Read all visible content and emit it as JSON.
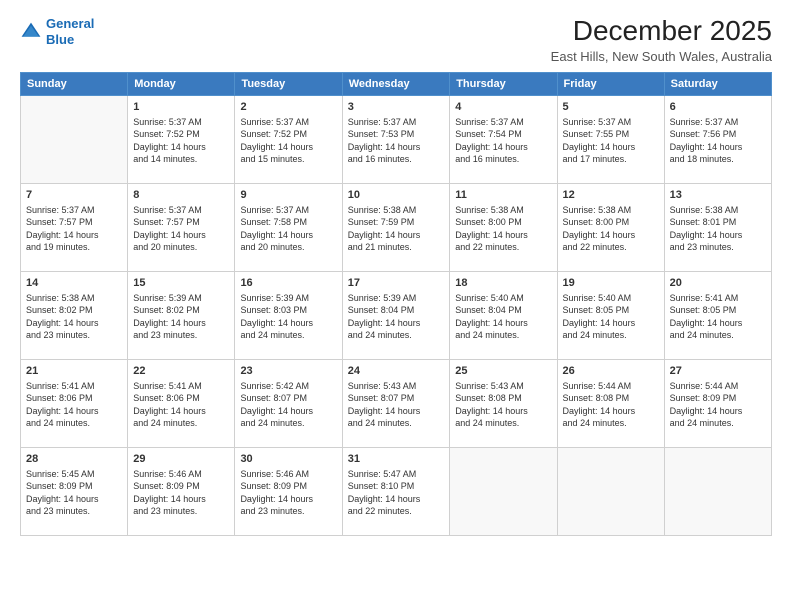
{
  "header": {
    "logo_line1": "General",
    "logo_line2": "Blue",
    "title": "December 2025",
    "subtitle": "East Hills, New South Wales, Australia"
  },
  "calendar": {
    "days_of_week": [
      "Sunday",
      "Monday",
      "Tuesday",
      "Wednesday",
      "Thursday",
      "Friday",
      "Saturday"
    ],
    "weeks": [
      [
        {
          "num": "",
          "info": ""
        },
        {
          "num": "1",
          "info": "Sunrise: 5:37 AM\nSunset: 7:52 PM\nDaylight: 14 hours\nand 14 minutes."
        },
        {
          "num": "2",
          "info": "Sunrise: 5:37 AM\nSunset: 7:52 PM\nDaylight: 14 hours\nand 15 minutes."
        },
        {
          "num": "3",
          "info": "Sunrise: 5:37 AM\nSunset: 7:53 PM\nDaylight: 14 hours\nand 16 minutes."
        },
        {
          "num": "4",
          "info": "Sunrise: 5:37 AM\nSunset: 7:54 PM\nDaylight: 14 hours\nand 16 minutes."
        },
        {
          "num": "5",
          "info": "Sunrise: 5:37 AM\nSunset: 7:55 PM\nDaylight: 14 hours\nand 17 minutes."
        },
        {
          "num": "6",
          "info": "Sunrise: 5:37 AM\nSunset: 7:56 PM\nDaylight: 14 hours\nand 18 minutes."
        }
      ],
      [
        {
          "num": "7",
          "info": "Sunrise: 5:37 AM\nSunset: 7:57 PM\nDaylight: 14 hours\nand 19 minutes."
        },
        {
          "num": "8",
          "info": "Sunrise: 5:37 AM\nSunset: 7:57 PM\nDaylight: 14 hours\nand 20 minutes."
        },
        {
          "num": "9",
          "info": "Sunrise: 5:37 AM\nSunset: 7:58 PM\nDaylight: 14 hours\nand 20 minutes."
        },
        {
          "num": "10",
          "info": "Sunrise: 5:38 AM\nSunset: 7:59 PM\nDaylight: 14 hours\nand 21 minutes."
        },
        {
          "num": "11",
          "info": "Sunrise: 5:38 AM\nSunset: 8:00 PM\nDaylight: 14 hours\nand 22 minutes."
        },
        {
          "num": "12",
          "info": "Sunrise: 5:38 AM\nSunset: 8:00 PM\nDaylight: 14 hours\nand 22 minutes."
        },
        {
          "num": "13",
          "info": "Sunrise: 5:38 AM\nSunset: 8:01 PM\nDaylight: 14 hours\nand 23 minutes."
        }
      ],
      [
        {
          "num": "14",
          "info": "Sunrise: 5:38 AM\nSunset: 8:02 PM\nDaylight: 14 hours\nand 23 minutes."
        },
        {
          "num": "15",
          "info": "Sunrise: 5:39 AM\nSunset: 8:02 PM\nDaylight: 14 hours\nand 23 minutes."
        },
        {
          "num": "16",
          "info": "Sunrise: 5:39 AM\nSunset: 8:03 PM\nDaylight: 14 hours\nand 24 minutes."
        },
        {
          "num": "17",
          "info": "Sunrise: 5:39 AM\nSunset: 8:04 PM\nDaylight: 14 hours\nand 24 minutes."
        },
        {
          "num": "18",
          "info": "Sunrise: 5:40 AM\nSunset: 8:04 PM\nDaylight: 14 hours\nand 24 minutes."
        },
        {
          "num": "19",
          "info": "Sunrise: 5:40 AM\nSunset: 8:05 PM\nDaylight: 14 hours\nand 24 minutes."
        },
        {
          "num": "20",
          "info": "Sunrise: 5:41 AM\nSunset: 8:05 PM\nDaylight: 14 hours\nand 24 minutes."
        }
      ],
      [
        {
          "num": "21",
          "info": "Sunrise: 5:41 AM\nSunset: 8:06 PM\nDaylight: 14 hours\nand 24 minutes."
        },
        {
          "num": "22",
          "info": "Sunrise: 5:41 AM\nSunset: 8:06 PM\nDaylight: 14 hours\nand 24 minutes."
        },
        {
          "num": "23",
          "info": "Sunrise: 5:42 AM\nSunset: 8:07 PM\nDaylight: 14 hours\nand 24 minutes."
        },
        {
          "num": "24",
          "info": "Sunrise: 5:43 AM\nSunset: 8:07 PM\nDaylight: 14 hours\nand 24 minutes."
        },
        {
          "num": "25",
          "info": "Sunrise: 5:43 AM\nSunset: 8:08 PM\nDaylight: 14 hours\nand 24 minutes."
        },
        {
          "num": "26",
          "info": "Sunrise: 5:44 AM\nSunset: 8:08 PM\nDaylight: 14 hours\nand 24 minutes."
        },
        {
          "num": "27",
          "info": "Sunrise: 5:44 AM\nSunset: 8:09 PM\nDaylight: 14 hours\nand 24 minutes."
        }
      ],
      [
        {
          "num": "28",
          "info": "Sunrise: 5:45 AM\nSunset: 8:09 PM\nDaylight: 14 hours\nand 23 minutes."
        },
        {
          "num": "29",
          "info": "Sunrise: 5:46 AM\nSunset: 8:09 PM\nDaylight: 14 hours\nand 23 minutes."
        },
        {
          "num": "30",
          "info": "Sunrise: 5:46 AM\nSunset: 8:09 PM\nDaylight: 14 hours\nand 23 minutes."
        },
        {
          "num": "31",
          "info": "Sunrise: 5:47 AM\nSunset: 8:10 PM\nDaylight: 14 hours\nand 22 minutes."
        },
        {
          "num": "",
          "info": ""
        },
        {
          "num": "",
          "info": ""
        },
        {
          "num": "",
          "info": ""
        }
      ]
    ]
  }
}
